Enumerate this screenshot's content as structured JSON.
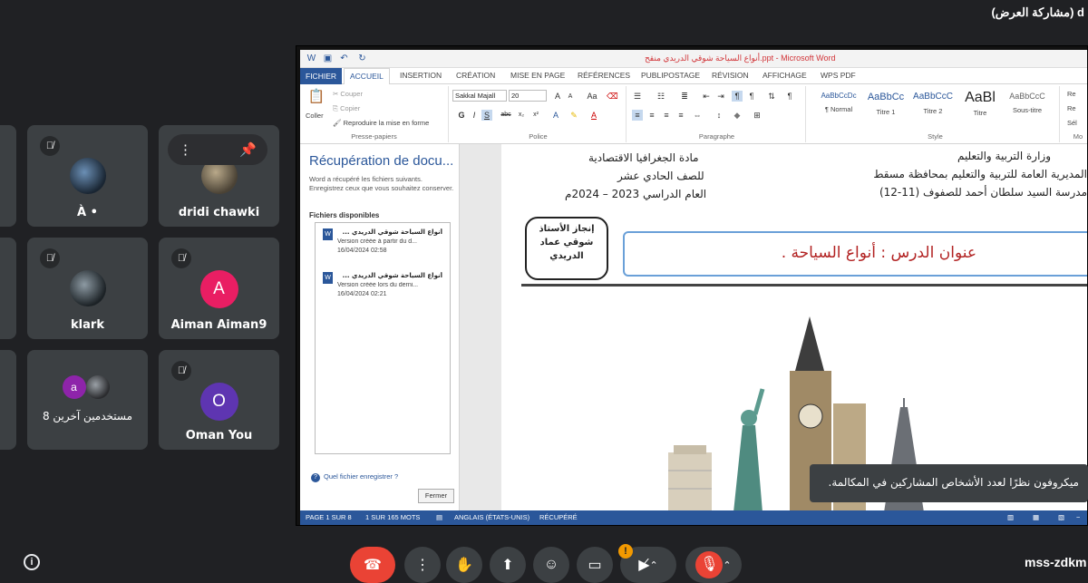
{
  "meet": {
    "presenter_label": "(مشاركة العرض) d",
    "meeting_code": "mss-zdkm",
    "info_icon": "info-icon",
    "toast_text": "ميكروفون نظرًا لعدد الأشخاص المشاركين في المكالمة."
  },
  "participants": [
    {
      "name": "À •",
      "muted": true
    },
    {
      "name": "dridi chawki",
      "muted": false
    },
    {
      "name": "klark",
      "muted": true
    },
    {
      "name": "Aiman Aiman9",
      "initial": "A",
      "muted": true,
      "color": "#e91e63"
    },
    {
      "name": "8 مستخدمين آخرين",
      "initial": "a",
      "muted": false,
      "color": "#8e24aa"
    },
    {
      "name": "Oman You",
      "initial": "O",
      "muted": true,
      "color": "#5e35b1"
    }
  ],
  "word": {
    "title": "أنواع السياحة شوقي الدريدي منقح.ppt - Microsoft Word",
    "tabs": [
      "FICHIER",
      "ACCUEIL",
      "INSERTION",
      "CRÉATION",
      "MISE EN PAGE",
      "RÉFÉRENCES",
      "PUBLIPOSTAGE",
      "RÉVISION",
      "AFFICHAGE",
      "WPS PDF"
    ],
    "clipboard": {
      "paste": "Coller",
      "cut": "Couper",
      "copy": "Copier",
      "format_painter": "Reproduire la mise en forme",
      "group": "Presse-papiers"
    },
    "font": {
      "name": "Sakkal Majall",
      "size": "20",
      "group": "Police",
      "bold": "G",
      "italic": "I",
      "underline": "S",
      "strike": "abc"
    },
    "paragraph_group": "Paragraphe",
    "styles": [
      {
        "preview": "AaBbCcDc",
        "label": "¶ Normal"
      },
      {
        "preview": "AaBbCc",
        "label": "Titre 1"
      },
      {
        "preview": "AaBbCcC",
        "label": "Titre 2"
      },
      {
        "preview": "AaBl",
        "label": "Titre"
      },
      {
        "preview": "AaBbCcC",
        "label": "Sous-titre"
      }
    ],
    "styles_group": "Style",
    "editing": [
      "Re",
      "Re",
      "Sél"
    ],
    "editing_group": "Mo",
    "recovery": {
      "title": "Récupération de docu...",
      "description": "Word a récupéré les fichiers suivants. Enregistrez ceux que vous souhaitez conserver.",
      "available": "Fichiers disponibles",
      "files": [
        {
          "name": "أنواع السياحة شوقي الدريدي ...",
          "status": "Version créée à partir du d...",
          "date": "16/04/2024 02:58"
        },
        {
          "name": "أنواع السياحة شوقي الدريدي ...",
          "status": "Version créée lors du derni...",
          "date": "16/04/2024 02:21"
        }
      ],
      "help": "Quel fichier enregistrer ?",
      "close": "Fermer"
    },
    "document": {
      "right_header": [
        "وزارة التربية والتعليم",
        "المديرية العامة للتربية والتعليم بمحافظة مسقط",
        "مدرسة السيد سلطان أحمد للصفوف (11-12)"
      ],
      "center_header": [
        "مادة الجغرافيا الاقتصادية",
        "للصف الحادي عشر",
        "العام الدراسي 2023 – 2024م"
      ],
      "author_box": [
        "إنجاز الأستاذ",
        "شوقي عماد",
        "الدريدي"
      ],
      "lesson_title": "عنوان الدرس : أنواع السياحة ."
    },
    "status_bar": [
      "PAGE 1 SUR 8",
      "1 SUR 165 MOTS",
      "ANGLAIS (ÉTATS-UNIS)",
      "RÉCUPÉRÉ"
    ]
  },
  "controls": [
    "end-call-icon",
    "more-options-icon",
    "raise-hand-icon",
    "present-icon",
    "emoji-icon",
    "captions-icon",
    "camera-off-icon",
    "mic-off-icon"
  ],
  "colors": {
    "meet_bg": "#202124",
    "tile": "#3c4043",
    "word_blue": "#2b579a",
    "end_call": "#ea4335"
  }
}
